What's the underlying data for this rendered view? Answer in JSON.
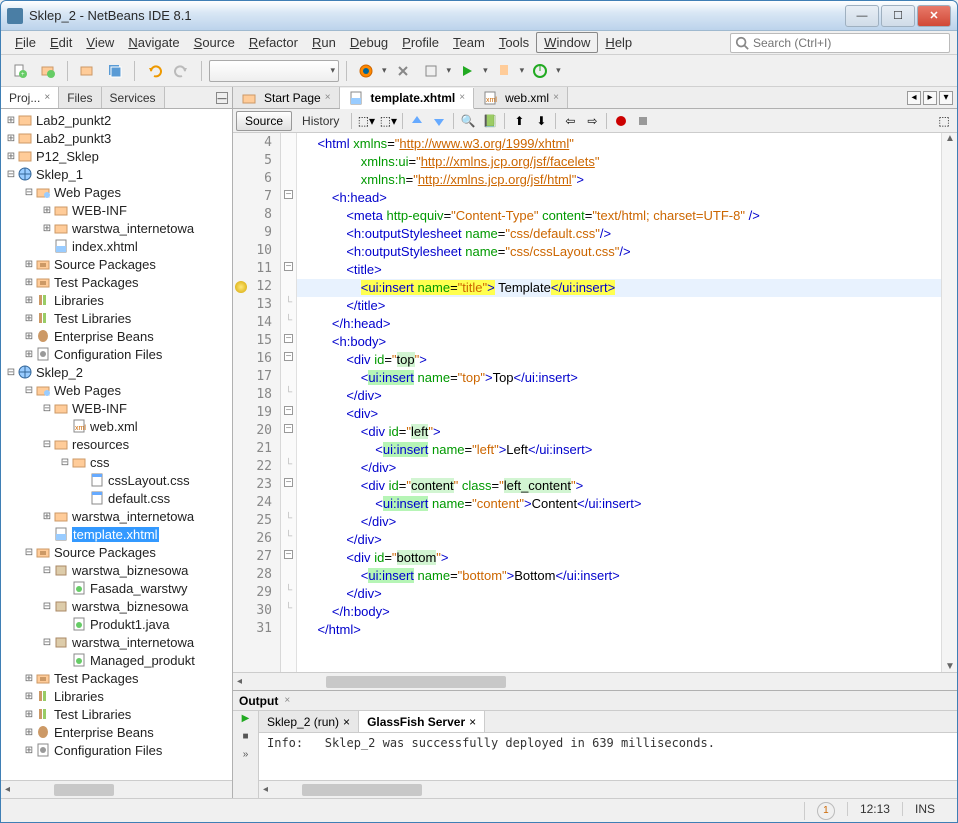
{
  "window": {
    "title": "Sklep_2 - NetBeans IDE 8.1"
  },
  "menu": {
    "items": [
      "File",
      "Edit",
      "View",
      "Navigate",
      "Source",
      "Refactor",
      "Run",
      "Debug",
      "Profile",
      "Team",
      "Tools",
      "Window",
      "Help"
    ],
    "boxed": "Window",
    "search_placeholder": "Search (Ctrl+I)"
  },
  "sidebar": {
    "tabs": {
      "projects_short": "Proj...",
      "files": "Files",
      "services": "Services"
    },
    "tree": [
      {
        "depth": 0,
        "exp": "+",
        "icon": "proj",
        "label": "Lab2_punkt2"
      },
      {
        "depth": 0,
        "exp": "+",
        "icon": "proj",
        "label": "Lab2_punkt3"
      },
      {
        "depth": 0,
        "exp": "+",
        "icon": "proj",
        "label": "P12_Sklep"
      },
      {
        "depth": 0,
        "exp": "-",
        "icon": "globe",
        "label": "Sklep_1"
      },
      {
        "depth": 1,
        "exp": "-",
        "icon": "folder-web",
        "label": "Web Pages"
      },
      {
        "depth": 2,
        "exp": "+",
        "icon": "folder",
        "label": "WEB-INF"
      },
      {
        "depth": 2,
        "exp": "+",
        "icon": "folder",
        "label": "warstwa_internetowa"
      },
      {
        "depth": 2,
        "exp": "",
        "icon": "xhtml",
        "label": "index.xhtml"
      },
      {
        "depth": 1,
        "exp": "+",
        "icon": "pkg",
        "label": "Source Packages"
      },
      {
        "depth": 1,
        "exp": "+",
        "icon": "pkg",
        "label": "Test Packages"
      },
      {
        "depth": 1,
        "exp": "+",
        "icon": "lib",
        "label": "Libraries"
      },
      {
        "depth": 1,
        "exp": "+",
        "icon": "lib",
        "label": "Test Libraries"
      },
      {
        "depth": 1,
        "exp": "+",
        "icon": "bean",
        "label": "Enterprise Beans"
      },
      {
        "depth": 1,
        "exp": "+",
        "icon": "conf",
        "label": "Configuration Files"
      },
      {
        "depth": 0,
        "exp": "-",
        "icon": "globe",
        "label": "Sklep_2"
      },
      {
        "depth": 1,
        "exp": "-",
        "icon": "folder-web",
        "label": "Web Pages"
      },
      {
        "depth": 2,
        "exp": "-",
        "icon": "folder",
        "label": "WEB-INF"
      },
      {
        "depth": 3,
        "exp": "",
        "icon": "xml",
        "label": "web.xml"
      },
      {
        "depth": 2,
        "exp": "-",
        "icon": "folder",
        "label": "resources"
      },
      {
        "depth": 3,
        "exp": "-",
        "icon": "folder",
        "label": "css"
      },
      {
        "depth": 4,
        "exp": "",
        "icon": "css",
        "label": "cssLayout.css"
      },
      {
        "depth": 4,
        "exp": "",
        "icon": "css",
        "label": "default.css"
      },
      {
        "depth": 2,
        "exp": "+",
        "icon": "folder",
        "label": "warstwa_internetowa"
      },
      {
        "depth": 2,
        "exp": "",
        "icon": "xhtml",
        "label": "template.xhtml",
        "selected": true
      },
      {
        "depth": 1,
        "exp": "-",
        "icon": "pkg",
        "label": "Source Packages"
      },
      {
        "depth": 2,
        "exp": "-",
        "icon": "pkg2",
        "label": "warstwa_biznesowa"
      },
      {
        "depth": 3,
        "exp": "",
        "icon": "java",
        "label": "Fasada_warstwy"
      },
      {
        "depth": 2,
        "exp": "-",
        "icon": "pkg2",
        "label": "warstwa_biznesowa"
      },
      {
        "depth": 3,
        "exp": "",
        "icon": "java",
        "label": "Produkt1.java"
      },
      {
        "depth": 2,
        "exp": "-",
        "icon": "pkg2",
        "label": "warstwa_internetowa"
      },
      {
        "depth": 3,
        "exp": "",
        "icon": "java",
        "label": "Managed_produkt"
      },
      {
        "depth": 1,
        "exp": "+",
        "icon": "pkg",
        "label": "Test Packages"
      },
      {
        "depth": 1,
        "exp": "+",
        "icon": "lib",
        "label": "Libraries"
      },
      {
        "depth": 1,
        "exp": "+",
        "icon": "lib",
        "label": "Test Libraries"
      },
      {
        "depth": 1,
        "exp": "+",
        "icon": "bean",
        "label": "Enterprise Beans"
      },
      {
        "depth": 1,
        "exp": "+",
        "icon": "conf",
        "label": "Configuration Files"
      }
    ]
  },
  "editor": {
    "tabs": [
      {
        "label": "Start Page",
        "active": false,
        "icon": "page"
      },
      {
        "label": "template.xhtml",
        "active": true,
        "icon": "xhtml"
      },
      {
        "label": "web.xml",
        "active": false,
        "icon": "xml"
      }
    ],
    "subtabs": {
      "source": "Source",
      "history": "History"
    },
    "line_start": 4,
    "lines": [
      {
        "n": 4,
        "fold": "",
        "indent": 1,
        "html": "<span class='k-tag'>&lt;html</span> <span class='k-attr'>xmlns</span>=<span class='k-val'>\"</span><span class='k-url'>http://www.w3.org/1999/xhtml</span><span class='k-val'>\"</span>"
      },
      {
        "n": 5,
        "fold": "",
        "indent": 4,
        "html": "<span class='k-attr'>xmlns:ui</span>=<span class='k-val'>\"</span><span class='k-url'>http://xmlns.jcp.org/jsf/facelets</span><span class='k-val'>\"</span>"
      },
      {
        "n": 6,
        "fold": "",
        "indent": 4,
        "html": "<span class='k-attr'>xmlns:h</span>=<span class='k-val'>\"</span><span class='k-url'>http://xmlns.jcp.org/jsf/html</span><span class='k-val'>\"</span><span class='k-tag'>&gt;</span>"
      },
      {
        "n": 7,
        "fold": "-",
        "indent": 2,
        "html": "<span class='k-tag'>&lt;h:head&gt;</span>"
      },
      {
        "n": 8,
        "fold": "",
        "indent": 3,
        "html": "<span class='k-tag'>&lt;meta</span> <span class='k-attr'>http-equiv</span>=<span class='k-val'>\"Content-Type\"</span> <span class='k-attr'>content</span>=<span class='k-val'>\"text/html; charset=UTF-8\"</span> <span class='k-tag'>/&gt;</span>"
      },
      {
        "n": 9,
        "fold": "",
        "indent": 3,
        "html": "<span class='k-tag'>&lt;h:outputStylesheet</span> <span class='k-attr'>name</span>=<span class='k-val'>\"css/default.css\"</span><span class='k-tag'>/&gt;</span>"
      },
      {
        "n": 10,
        "fold": "",
        "indent": 3,
        "html": "<span class='k-tag'>&lt;h:outputStylesheet</span> <span class='k-attr'>name</span>=<span class='k-val'>\"css/cssLayout.css\"</span><span class='k-tag'>/&gt;</span>"
      },
      {
        "n": 11,
        "fold": "-",
        "indent": 3,
        "html": "<span class='k-tag'>&lt;title&gt;</span>"
      },
      {
        "n": 12,
        "fold": "",
        "indent": 4,
        "html": "<span class='hl-yellow'><span class='k-tag'>&lt;ui:insert</span> <span class='k-attr'>name</span>=<span class='k-val'>\"title\"</span><span class='k-tag'>&gt;</span></span> Template<span class='hl-yellow'><span class='k-tag'>&lt;/ui:insert&gt;</span></span>",
        "hl": true,
        "bulb": true
      },
      {
        "n": 13,
        "fold": "e",
        "indent": 3,
        "html": "<span class='k-tag'>&lt;/title&gt;</span>"
      },
      {
        "n": 14,
        "fold": "e",
        "indent": 2,
        "html": "<span class='k-tag'>&lt;/h:head&gt;</span>"
      },
      {
        "n": 15,
        "fold": "-",
        "indent": 2,
        "html": "<span class='k-tag'>&lt;h:body&gt;</span>"
      },
      {
        "n": 16,
        "fold": "-",
        "indent": 3,
        "html": "<span class='k-tag'>&lt;div</span> <span class='k-attr'>id</span>=<span class='k-val'>\"</span><span class='hl-top'>top</span><span class='k-val'>\"</span><span class='k-tag'>&gt;</span>"
      },
      {
        "n": 17,
        "fold": "",
        "indent": 4,
        "html": "<span class='k-tag'>&lt;<span class='hl-green'>ui:insert</span></span> <span class='k-attr'>name</span>=<span class='k-val'>\"top\"</span><span class='k-tag'>&gt;</span>Top<span class='k-tag'>&lt;/ui:insert&gt;</span>"
      },
      {
        "n": 18,
        "fold": "e",
        "indent": 3,
        "html": "<span class='k-tag'>&lt;/div&gt;</span>"
      },
      {
        "n": 19,
        "fold": "-",
        "indent": 3,
        "html": "<span class='k-tag'>&lt;div&gt;</span>"
      },
      {
        "n": 20,
        "fold": "-",
        "indent": 4,
        "html": "<span class='k-tag'>&lt;div</span> <span class='k-attr'>id</span>=<span class='k-val'>\"</span><span class='hl-top'>left</span><span class='k-val'>\"</span><span class='k-tag'>&gt;</span>"
      },
      {
        "n": 21,
        "fold": "",
        "indent": 5,
        "html": "<span class='k-tag'>&lt;<span class='hl-green'>ui:insert</span></span> <span class='k-attr'>name</span>=<span class='k-val'>\"left\"</span><span class='k-tag'>&gt;</span>Left<span class='k-tag'>&lt;/ui:insert&gt;</span>"
      },
      {
        "n": 22,
        "fold": "e",
        "indent": 4,
        "html": "<span class='k-tag'>&lt;/div&gt;</span>"
      },
      {
        "n": 23,
        "fold": "-",
        "indent": 4,
        "html": "<span class='k-tag'>&lt;div</span> <span class='k-attr'>id</span>=<span class='k-val'>\"</span><span class='hl-top'>content</span><span class='k-val'>\"</span> <span class='k-attr'>class</span>=<span class='k-val'>\"</span><span class='hl-top'>left_content</span><span class='k-val'>\"</span><span class='k-tag'>&gt;</span>"
      },
      {
        "n": 24,
        "fold": "",
        "indent": 5,
        "html": "<span class='k-tag'>&lt;<span class='hl-green'>ui:insert</span></span> <span class='k-attr'>name</span>=<span class='k-val'>\"content\"</span><span class='k-tag'>&gt;</span>Content<span class='k-tag'>&lt;/ui:insert&gt;</span>"
      },
      {
        "n": 25,
        "fold": "e",
        "indent": 4,
        "html": "<span class='k-tag'>&lt;/div&gt;</span>"
      },
      {
        "n": 26,
        "fold": "e",
        "indent": 3,
        "html": "<span class='k-tag'>&lt;/div&gt;</span>"
      },
      {
        "n": 27,
        "fold": "-",
        "indent": 3,
        "html": "<span class='k-tag'>&lt;div</span> <span class='k-attr'>id</span>=<span class='k-val'>\"</span><span class='hl-top'>bottom</span><span class='k-val'>\"</span><span class='k-tag'>&gt;</span>"
      },
      {
        "n": 28,
        "fold": "",
        "indent": 4,
        "html": "<span class='k-tag'>&lt;<span class='hl-green'>ui:insert</span></span> <span class='k-attr'>name</span>=<span class='k-val'>\"bottom\"</span><span class='k-tag'>&gt;</span>Bottom<span class='k-tag'>&lt;/ui:insert&gt;</span>"
      },
      {
        "n": 29,
        "fold": "e",
        "indent": 3,
        "html": "<span class='k-tag'>&lt;/div&gt;</span>"
      },
      {
        "n": 30,
        "fold": "e",
        "indent": 2,
        "html": "<span class='k-tag'>&lt;/h:body&gt;</span>"
      },
      {
        "n": 31,
        "fold": "",
        "indent": 1,
        "html": "<span class='k-tag'>&lt;/html&gt;</span>"
      }
    ]
  },
  "output": {
    "title": "Output",
    "tabs": [
      {
        "label": "Sklep_2 (run)",
        "active": false
      },
      {
        "label": "GlassFish Server",
        "active": true
      }
    ],
    "log": "Info:   Sklep_2 was successfully deployed in 639 milliseconds."
  },
  "statusbar": {
    "notif_count": "1",
    "time": "12:13",
    "ins": "INS"
  }
}
